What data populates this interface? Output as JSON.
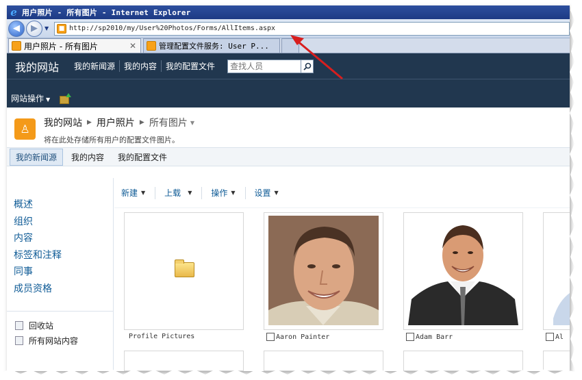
{
  "browser": {
    "window_title": "用户照片 - 所有图片 - Internet Explorer",
    "url": "http://sp2010/my/User%20Photos/Forms/AllItems.aspx",
    "tabs": [
      {
        "label": "用户照片 - 所有图片",
        "active": true
      },
      {
        "label": "管理配置文件服务: User P...",
        "active": false
      }
    ]
  },
  "header": {
    "my_site": "我的网站",
    "nav": [
      "我的新闻源",
      "我的内容",
      "我的配置文件"
    ],
    "search_placeholder": "查找人员"
  },
  "site_actions": {
    "label": "网站操作"
  },
  "page": {
    "breadcrumb": [
      "我的网站",
      "用户照片",
      "所有图片"
    ],
    "description": "将在此处存储所有用户的配置文件图片。"
  },
  "top_links": [
    {
      "label": "我的新闻源",
      "selected": true
    },
    {
      "label": "我的内容",
      "selected": false
    },
    {
      "label": "我的配置文件",
      "selected": false
    }
  ],
  "quick_launch": [
    "概述",
    "组织",
    "内容",
    "标签和注释",
    "同事",
    "成员资格"
  ],
  "nav_bottom": [
    "回收站",
    "所有网站内容"
  ],
  "ribbon": [
    "新建",
    "上载",
    "操作",
    "设置"
  ],
  "tiles": [
    {
      "caption": "Profile Pictures",
      "kind": "folder",
      "checkbox": false
    },
    {
      "caption": "Aaron Painter",
      "kind": "photo",
      "checkbox": true
    },
    {
      "caption": "Adam Barr",
      "kind": "photo",
      "checkbox": true
    },
    {
      "caption": "Al",
      "kind": "photo",
      "checkbox": true
    }
  ],
  "colors": {
    "header_bg": "#21374f",
    "link": "#0f5b96",
    "accent_orange": "#f49a19",
    "annotation_arrow": "#d81e1e"
  }
}
